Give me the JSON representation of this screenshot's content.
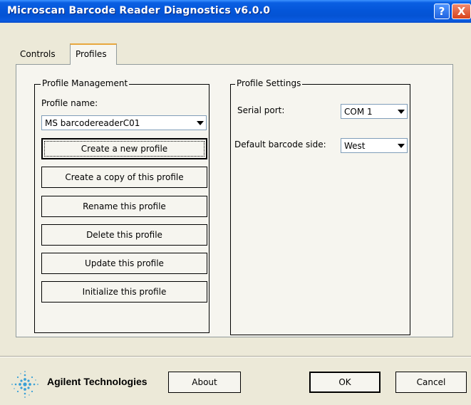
{
  "window": {
    "title": "Microscan Barcode Reader Diagnostics v6.0.0",
    "help_glyph": "?",
    "close_glyph": "X"
  },
  "tabs": [
    {
      "label": "Controls"
    },
    {
      "label": "Profiles"
    }
  ],
  "profile_management": {
    "legend": "Profile Management",
    "profile_name_label": "Profile name:",
    "profile_name_value": "MS barcodereaderC01",
    "buttons": [
      {
        "label": "Create a new profile"
      },
      {
        "label": "Create a copy of this profile"
      },
      {
        "label": "Rename this profile"
      },
      {
        "label": "Delete this profile"
      },
      {
        "label": "Update this profile"
      },
      {
        "label": "Initialize this profile"
      }
    ]
  },
  "profile_settings": {
    "legend": "Profile Settings",
    "serial_port_label": "Serial port:",
    "serial_port_value": "COM 1",
    "default_side_label": "Default barcode side:",
    "default_side_value": "West"
  },
  "footer": {
    "company": "Agilent Technologies",
    "about_label": "About",
    "ok_label": "OK",
    "cancel_label": "Cancel"
  },
  "colors": {
    "titlebar": "#0a5fe3",
    "dialog_bg": "#ece9d8",
    "tab_page_bg": "#f6f5ef",
    "logo": "#3aa0d6"
  },
  "icons": {
    "logo": "agilent-spark-logo",
    "help": "help-icon",
    "close": "close-icon",
    "dropdown": "chevron-down-icon"
  }
}
